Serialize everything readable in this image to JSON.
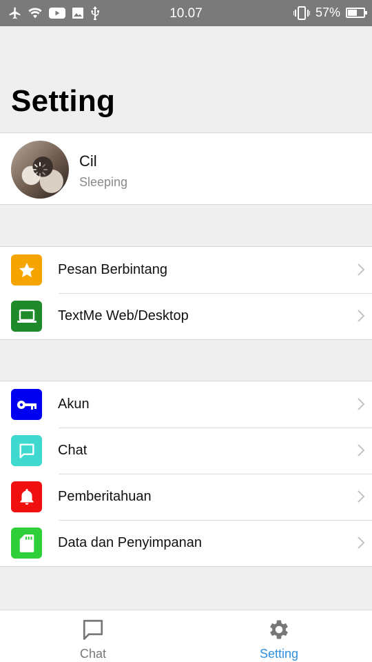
{
  "status_bar": {
    "time": "10.07",
    "battery_percent": "57%",
    "battery_level": 0.57,
    "icons": [
      "airplane-icon",
      "wifi-icon",
      "youtube-icon",
      "image-icon",
      "usb-icon",
      "vibrate-icon"
    ]
  },
  "page": {
    "title": "Setting"
  },
  "profile": {
    "name": "Cil",
    "status": "Sleeping"
  },
  "group1": [
    {
      "label": "Pesan Berbintang",
      "icon": "star-icon",
      "color": "#f6a400"
    },
    {
      "label": "TextMe Web/Desktop",
      "icon": "laptop-icon",
      "color": "#1e8a2a"
    }
  ],
  "group2": [
    {
      "label": "Akun",
      "icon": "key-icon",
      "color": "#0000f0"
    },
    {
      "label": "Chat",
      "icon": "chat-bubble-icon",
      "color": "#3fd9cf"
    },
    {
      "label": "Pemberitahuan",
      "icon": "bell-icon",
      "color": "#f01010"
    },
    {
      "label": "Data dan Penyimpanan",
      "icon": "sd-card-icon",
      "color": "#2fcf3a"
    }
  ],
  "tabbar": {
    "tabs": [
      {
        "label": "Chat",
        "icon": "chat-bubble-icon",
        "active": false
      },
      {
        "label": "Setting",
        "icon": "gear-icon",
        "active": true
      }
    ],
    "active_color": "#2e8fde",
    "inactive_color": "#777777"
  }
}
